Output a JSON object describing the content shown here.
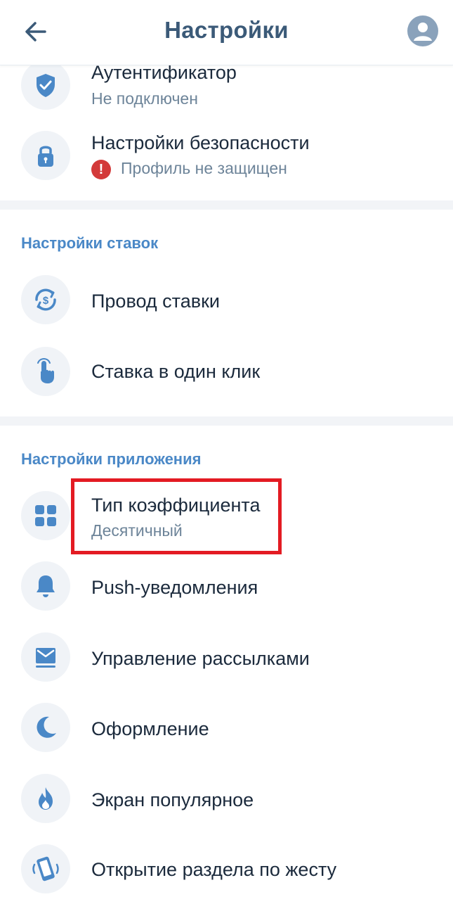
{
  "header": {
    "title": "Настройки"
  },
  "security": {
    "authenticator": {
      "title": "Аутентификатор",
      "status": "Не подключен"
    },
    "security_settings": {
      "title": "Настройки безопасности",
      "status": "Профиль не защищен",
      "alert": "!"
    }
  },
  "bet_settings": {
    "section_title": "Настройки ставок",
    "items": [
      {
        "title": "Провод ставки"
      },
      {
        "title": "Ставка в один клик"
      }
    ]
  },
  "app_settings": {
    "section_title": "Настройки приложения",
    "coefficient": {
      "title": "Тип коэффициента",
      "value": "Десятичный"
    },
    "items": [
      {
        "title": "Push-уведомления"
      },
      {
        "title": "Управление рассылками"
      },
      {
        "title": "Оформление"
      },
      {
        "title": "Экран популярное"
      },
      {
        "title": "Открытие раздела по жесту"
      }
    ]
  },
  "colors": {
    "accent": "#4a88c7",
    "title": "#3b5a78",
    "alert": "#d33a3a",
    "highlight": "#e31b23"
  }
}
